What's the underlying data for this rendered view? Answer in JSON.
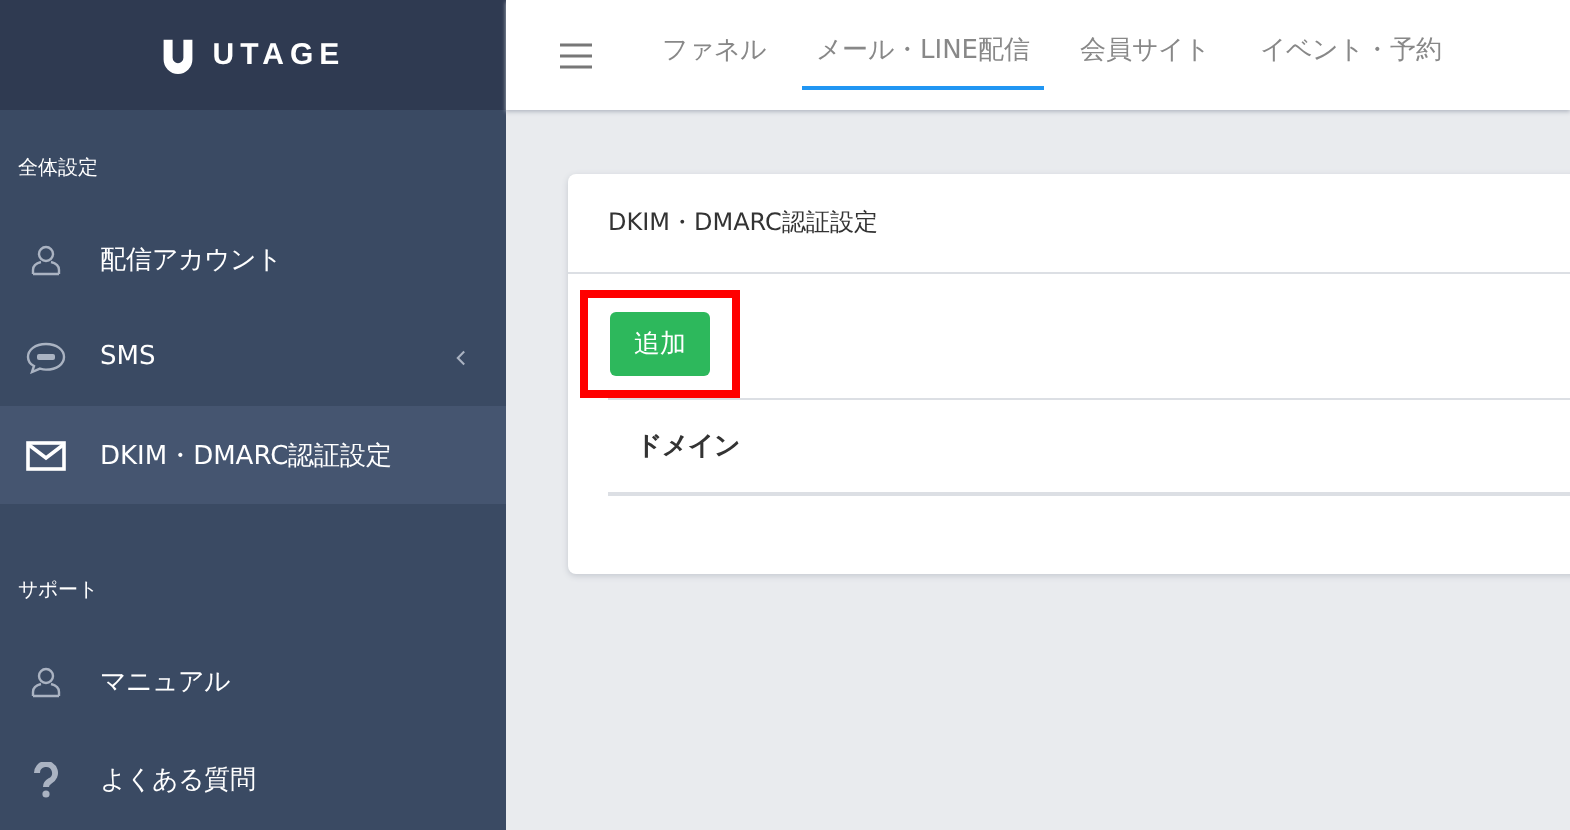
{
  "logo": {
    "text": "UTAGE"
  },
  "sidebar": {
    "sections": [
      {
        "label": "全体設定",
        "items": [
          {
            "label": "配信アカウント",
            "kind": "person",
            "selected": false,
            "has_submenu": false
          },
          {
            "label": "SMS",
            "kind": "sms",
            "selected": false,
            "has_submenu": true
          },
          {
            "label": "DKIM・DMARC認証設定",
            "kind": "mail",
            "selected": true,
            "has_submenu": false
          }
        ]
      },
      {
        "label": "サポート",
        "items": [
          {
            "label": "マニュアル",
            "kind": "person",
            "selected": false,
            "has_submenu": false
          },
          {
            "label": "よくある質問",
            "kind": "question",
            "selected": false,
            "has_submenu": false
          }
        ]
      }
    ]
  },
  "topnav": {
    "tabs": [
      {
        "label": "ファネル",
        "selected": false
      },
      {
        "label": "メール・LINE配信",
        "selected": true
      },
      {
        "label": "会員サイト",
        "selected": false
      },
      {
        "label": "イベント・予約",
        "selected": false
      }
    ]
  },
  "card": {
    "title": "DKIM・DMARC認証設定",
    "add_button": {
      "label": "追加",
      "highlighted": true
    },
    "table": {
      "columns": [
        "ドメイン"
      ]
    }
  }
}
